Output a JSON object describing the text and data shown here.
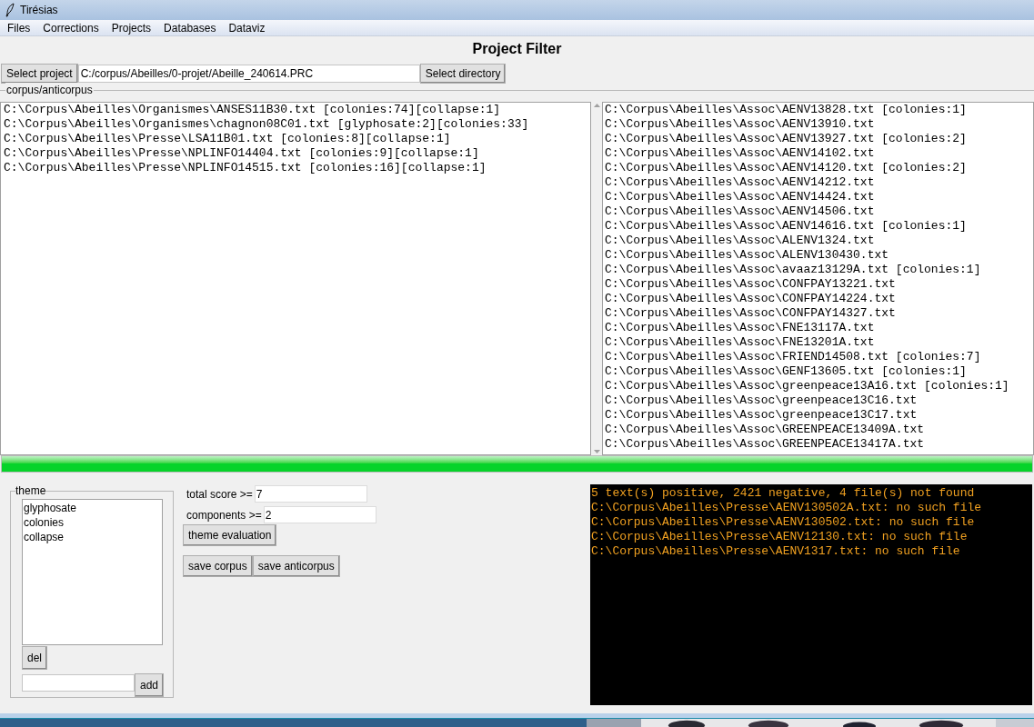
{
  "window": {
    "title": "Tirésias"
  },
  "menu": [
    "Files",
    "Corrections",
    "Projects",
    "Databases",
    "Dataviz"
  ],
  "heading": "Project Filter",
  "project": {
    "button": "Select project",
    "path": "C:/corpus/Abeilles/0-projet/Abeille_240614.PRC",
    "directory_button": "Select directory"
  },
  "corpus_group": {
    "label": "corpus/anticorpus",
    "corpus": [
      "C:\\Corpus\\Abeilles\\Organismes\\ANSES11B30.txt [colonies:74][collapse:1]",
      "C:\\Corpus\\Abeilles\\Organismes\\chagnon08C01.txt [glyphosate:2][colonies:33]",
      "C:\\Corpus\\Abeilles\\Presse\\LSA11B01.txt [colonies:8][collapse:1]",
      "C:\\Corpus\\Abeilles\\Presse\\NPLINFO14404.txt [colonies:9][collapse:1]",
      "C:\\Corpus\\Abeilles\\Presse\\NPLINFO14515.txt [colonies:16][collapse:1]"
    ],
    "anticorpus": [
      "C:\\Corpus\\Abeilles\\Assoc\\AENV13828.txt [colonies:1]",
      "C:\\Corpus\\Abeilles\\Assoc\\AENV13910.txt",
      "C:\\Corpus\\Abeilles\\Assoc\\AENV13927.txt [colonies:2]",
      "C:\\Corpus\\Abeilles\\Assoc\\AENV14102.txt",
      "C:\\Corpus\\Abeilles\\Assoc\\AENV14120.txt [colonies:2]",
      "C:\\Corpus\\Abeilles\\Assoc\\AENV14212.txt",
      "C:\\Corpus\\Abeilles\\Assoc\\AENV14424.txt",
      "C:\\Corpus\\Abeilles\\Assoc\\AENV14506.txt",
      "C:\\Corpus\\Abeilles\\Assoc\\AENV14616.txt [colonies:1]",
      "C:\\Corpus\\Abeilles\\Assoc\\ALENV1324.txt",
      "C:\\Corpus\\Abeilles\\Assoc\\ALENV130430.txt",
      "C:\\Corpus\\Abeilles\\Assoc\\avaaz13129A.txt [colonies:1]",
      "C:\\Corpus\\Abeilles\\Assoc\\CONFPAY13221.txt",
      "C:\\Corpus\\Abeilles\\Assoc\\CONFPAY14224.txt",
      "C:\\Corpus\\Abeilles\\Assoc\\CONFPAY14327.txt",
      "C:\\Corpus\\Abeilles\\Assoc\\FNE13117A.txt",
      "C:\\Corpus\\Abeilles\\Assoc\\FNE13201A.txt",
      "C:\\Corpus\\Abeilles\\Assoc\\FRIEND14508.txt [colonies:7]",
      "C:\\Corpus\\Abeilles\\Assoc\\GENF13605.txt [colonies:1]",
      "C:\\Corpus\\Abeilles\\Assoc\\greenpeace13A16.txt [colonies:1]",
      "C:\\Corpus\\Abeilles\\Assoc\\greenpeace13C16.txt",
      "C:\\Corpus\\Abeilles\\Assoc\\greenpeace13C17.txt",
      "C:\\Corpus\\Abeilles\\Assoc\\GREENPEACE13409A.txt",
      "C:\\Corpus\\Abeilles\\Assoc\\GREENPEACE13417A.txt"
    ]
  },
  "progress": {
    "level": 1
  },
  "theme": {
    "label": "theme",
    "items": [
      "glyphosate",
      "colonies",
      "collapse"
    ],
    "del_button": "del",
    "add_button": "add"
  },
  "filters": {
    "total_score_label": "total score >=",
    "total_score": "7",
    "components_label": "components >=",
    "components": "2",
    "evaluate_button": "theme evaluation",
    "save_corpus_button": "save corpus",
    "save_anticorpus_button": "save anticorpus"
  },
  "console": [
    "5 text(s) positive, 2421 negative, 4 file(s) not found",
    "C:\\Corpus\\Abeilles\\Presse\\AENV130502A.txt: no such file",
    "C:\\Corpus\\Abeilles\\Presse\\AENV130502.txt: no such file",
    "C:\\Corpus\\Abeilles\\Presse\\AENV12130.txt: no such file",
    "C:\\Corpus\\Abeilles\\Presse\\AENV1317.txt: no such file"
  ]
}
